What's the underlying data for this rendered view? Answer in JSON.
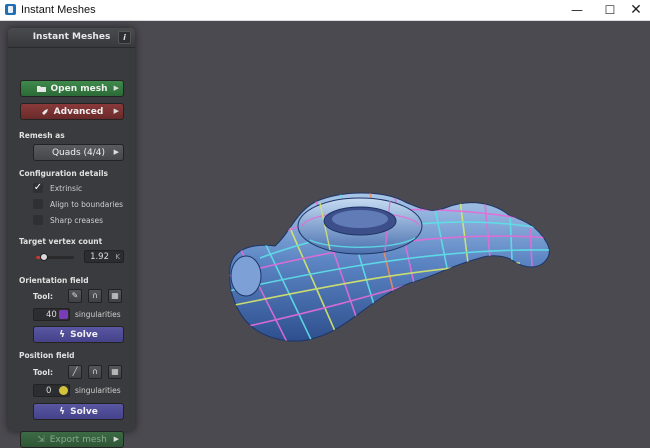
{
  "window": {
    "title": "Instant Meshes",
    "minimize": "—",
    "maximize": "☐",
    "close": "✕"
  },
  "panel": {
    "title": "Instant Meshes",
    "info": "i",
    "open_mesh": "Open mesh",
    "advanced": "Advanced",
    "remesh_as_label": "Remesh as",
    "remesh_as_value": "Quads (4/4)",
    "configuration_label": "Configuration details",
    "options": [
      {
        "label": "Extrinsic",
        "checked": true
      },
      {
        "label": "Align to boundaries",
        "checked": false
      },
      {
        "label": "Sharp creases",
        "checked": false
      }
    ],
    "target_vertex_label": "Target vertex count",
    "target_vertex_value": "1.92",
    "target_vertex_unit": "K",
    "target_vertex_slider": 0.2,
    "orientation_label": "Orientation field",
    "tool_label": "Tool:",
    "orientation_singularities": "40",
    "singularities_label": "singularities",
    "solve": "Solve",
    "position_label": "Position field",
    "position_singularities": "0",
    "export_mesh": "Export mesh"
  },
  "colors": {
    "open_mesh": "#3f8a4c",
    "advanced": "#8a3a3a",
    "solve": "#5a57a3",
    "slider": "#b83a3a",
    "orient_dot": "#7b3ab8",
    "pos_dot": "#d4c23a"
  },
  "icons": [
    "folder-icon",
    "rocket-icon",
    "chevron-right-icon",
    "comb-icon",
    "brush-icon",
    "attractor-icon",
    "lightning-icon",
    "share-icon"
  ]
}
